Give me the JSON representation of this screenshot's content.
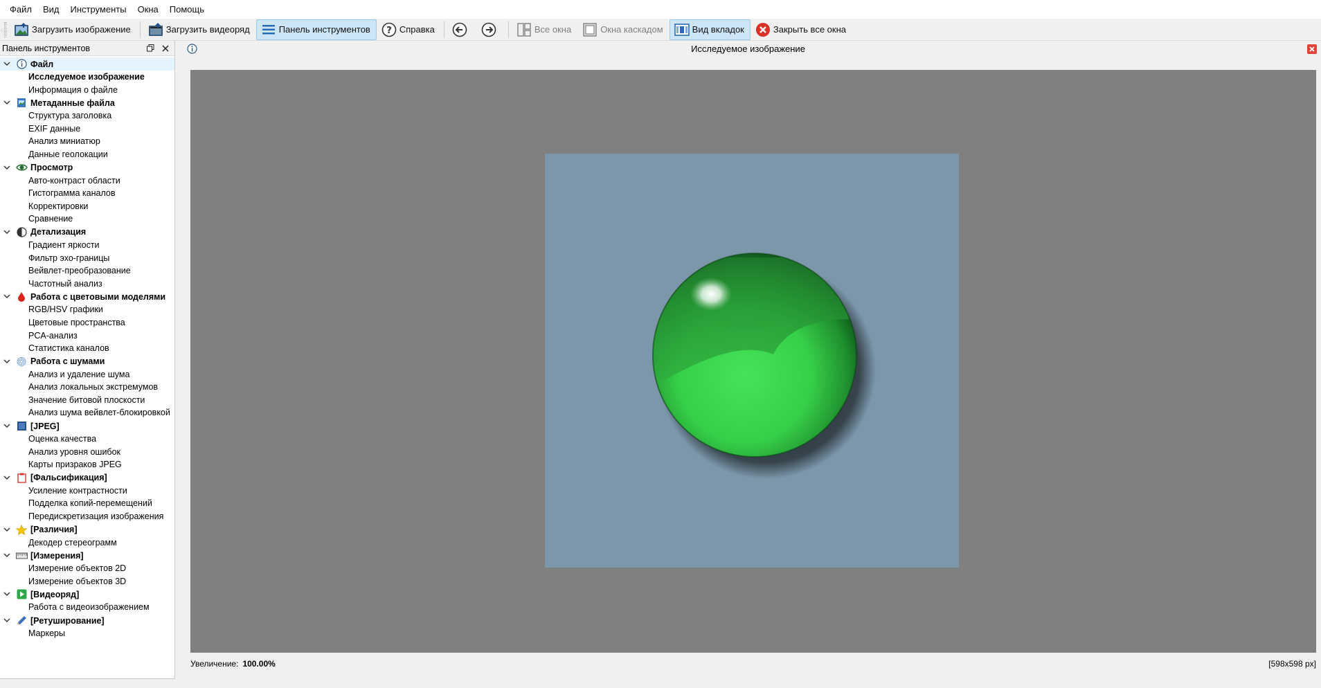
{
  "menu": [
    "Файл",
    "Вид",
    "Инструменты",
    "Окна",
    "Помощь"
  ],
  "toolbar": {
    "load_image": "Загрузить изображение",
    "load_video": "Загрузить видеоряд",
    "tools_panel": "Панель инструментов",
    "help": "Справка",
    "all_windows": "Все окна",
    "cascade": "Окна каскадом",
    "tab_view": "Вид вкладок",
    "close_all": "Закрыть все окна"
  },
  "dock": {
    "title": "Панель инструментов",
    "groups": [
      {
        "label": "Файл",
        "icon": "info-icon",
        "items": [
          "Исследуемое изображение",
          "Информация о файле"
        ]
      },
      {
        "label": "Метаданные файла",
        "icon": "metadata-icon",
        "items": [
          "Структура заголовка",
          "EXIF данные",
          "Анализ миниатюр",
          "Данные геолокации"
        ]
      },
      {
        "label": "Просмотр",
        "icon": "eye-icon",
        "items": [
          "Авто-контраст области",
          "Гистограмма каналов",
          "Корректировки",
          "Сравнение"
        ]
      },
      {
        "label": "Детализация",
        "icon": "contrast-icon",
        "items": [
          "Градиент яркости",
          "Фильтр эхо-границы",
          "Вейвлет-преобразование",
          "Частотный анализ"
        ]
      },
      {
        "label": "Работа с цветовыми моделями",
        "icon": "drop-icon",
        "items": [
          "RGB/HSV графики",
          "Цветовые пространства",
          "PCA-анализ",
          "Статистика каналов"
        ]
      },
      {
        "label": "Работа с шумами",
        "icon": "fingerprint-icon",
        "items": [
          "Анализ и удаление шума",
          "Анализ локальных экстремумов",
          "Значение битовой плоскости",
          "Анализ шума вейвлет-блокировкой"
        ]
      },
      {
        "label": "[JPEG]",
        "icon": "jpeg-icon",
        "items": [
          "Оценка качества",
          "Анализ уровня ошибок",
          "Карты призраков JPEG"
        ]
      },
      {
        "label": "[Фальсификация]",
        "icon": "clipboard-icon",
        "items": [
          "Усиление контрастности",
          "Подделка копий-перемещений",
          "Передискретизация изображения"
        ]
      },
      {
        "label": "[Различия]",
        "icon": "star-icon",
        "items": [
          "Декодер стереограмм"
        ]
      },
      {
        "label": "[Измерения]",
        "icon": "ruler-icon",
        "items": [
          "Измерение объектов 2D",
          "Измерение объектов 3D"
        ]
      },
      {
        "label": "[Видеоряд]",
        "icon": "play-icon",
        "items": [
          "Работа с видеоизображением"
        ]
      },
      {
        "label": "[Ретуширование]",
        "icon": "pen-icon",
        "items": [
          "Маркеры"
        ]
      }
    ]
  },
  "main": {
    "title": "Исследуемое изображение",
    "zoom_label": "Увеличение:",
    "zoom_value": "100.00%",
    "image_size": "[598x598 px]"
  },
  "colors": {
    "viewport_bg": "#808080",
    "image_bg": "#7b97a9",
    "sphere_green": "#3ccf4e",
    "active_button": "#cde6f7"
  }
}
